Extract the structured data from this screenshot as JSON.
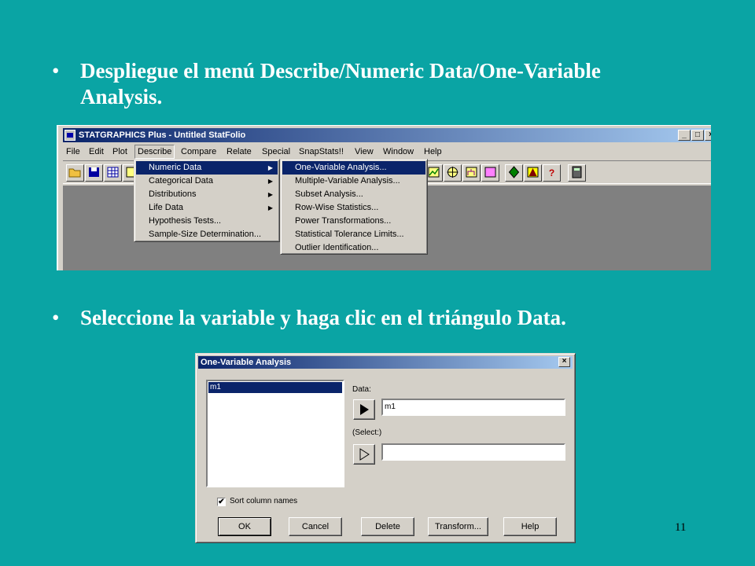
{
  "bullets": [
    "Despliegue el menú Describe/Numeric Data/One-Variable Analysis.",
    "Seleccione la variable y haga clic en el triángulo Data."
  ],
  "bullet_symbol": "•",
  "app_window": {
    "title": "STATGRAPHICS Plus - Untitled StatFolio",
    "controls": {
      "minimize": "_",
      "maximize": "□",
      "close": "×"
    },
    "menu": [
      "File",
      "Edit",
      "Plot",
      "Describe",
      "Compare",
      "Relate",
      "Special",
      "SnapStats!!",
      "View",
      "Window",
      "Help"
    ],
    "active_menu": "Describe",
    "describe_menu": [
      "Numeric Data",
      "Categorical Data",
      "Distributions",
      "Life Data",
      "Hypothesis Tests...",
      "Sample-Size Determination..."
    ],
    "numeric_data_submenu": [
      "One-Variable Analysis...",
      "Multiple-Variable Analysis...",
      "Subset Analysis...",
      "Row-Wise Statistics...",
      "Power Transformations...",
      "Statistical Tolerance Limits...",
      "Outlier Identification..."
    ],
    "toolbar_glyphs": {
      "help": "?"
    },
    "accent_color": "#0a246a"
  },
  "dialog": {
    "title": "One-Variable Analysis",
    "close": "×",
    "variables": [
      "m1"
    ],
    "data_label": "Data:",
    "data_value": "m1",
    "select_label": "(Select:)",
    "select_value": "",
    "sort_label": "Sort column names",
    "sort_checked": "✔",
    "buttons": [
      "OK",
      "Cancel",
      "Delete",
      "Transform...",
      "Help"
    ]
  },
  "page_number": "11"
}
